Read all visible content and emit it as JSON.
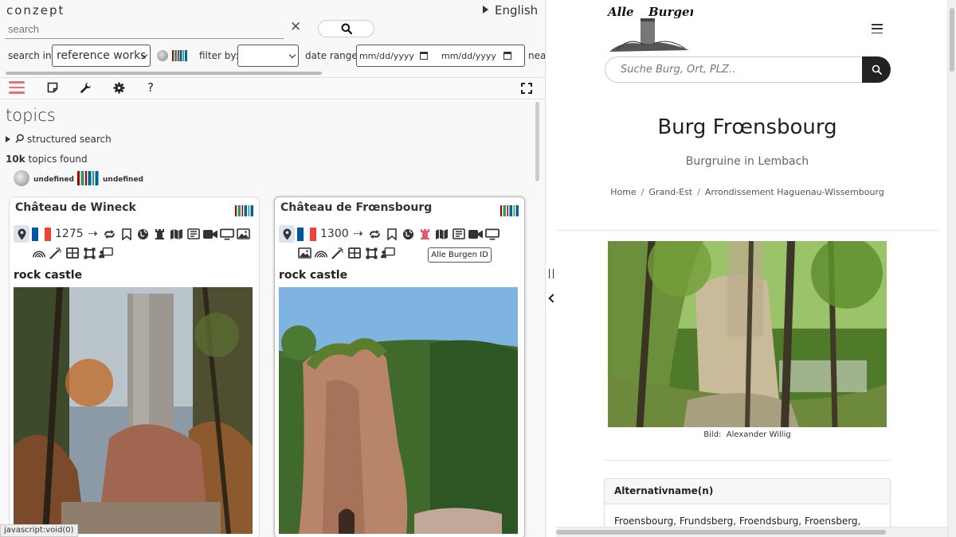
{
  "left": {
    "brand": "conzept",
    "language": "English",
    "search": {
      "placeholder": "search"
    },
    "search_in_label": "search in:",
    "search_in_value": "reference works",
    "filter_label": "filter by:",
    "date_label": "date range:",
    "date_from": "mm/dd/yyyy",
    "date_to": "mm/dd/yyyy",
    "near_label": "nea",
    "topics_title": "topics",
    "structured_search": "structured search",
    "found_count": "10k",
    "found_text": "topics found",
    "source_wikipedia": "undefined",
    "source_wikidata": "undefined",
    "cards": [
      {
        "title": "Château de Wineck",
        "year": "1275",
        "subtitle": "rock castle"
      },
      {
        "title": "Château de Frœnsbourg",
        "year": "1300",
        "subtitle": "rock castle"
      }
    ],
    "tooltip": "Alle Burgen ID",
    "status_bar": "javascript:void(0)"
  },
  "right": {
    "logo_text_1": "Alle",
    "logo_text_2": "Burgen",
    "search_placeholder": "Suche Burg, Ort, PLZ..",
    "title": "Burg Frœnsbourg",
    "subtitle": "Burgruine in Lembach",
    "breadcrumbs": [
      "Home",
      "Grand-Est",
      "Arrondissement Haguenau-Wissembourg"
    ],
    "photo_caption_label": "Bild:",
    "photo_caption_author": "Alexander Willig",
    "alt_names_header": "Alternativname(n)",
    "alt_names_value": "Froensbourg, Frundsberg, Froendsburg, Froensberg,"
  },
  "colors": {
    "menu_accent": "#e8707c",
    "active_icon": "#e65b6b",
    "flag_blue": "#0055a4",
    "flag_red": "#ef4135"
  }
}
